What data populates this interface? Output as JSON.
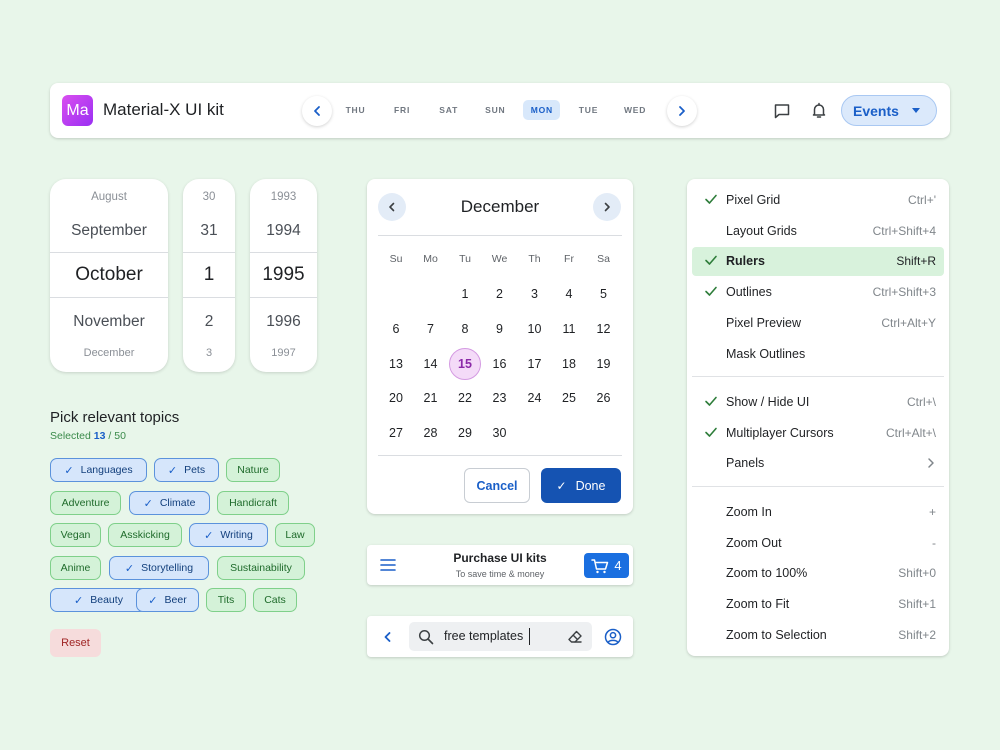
{
  "topbar": {
    "logo_text": "Ma",
    "title": "Material-X UI kit",
    "days": [
      "THU",
      "FRI",
      "SAT",
      "SUN",
      "MON",
      "TUE",
      "WED"
    ],
    "active_day": "MON",
    "events_label": "Events"
  },
  "pickers": {
    "month": [
      "August",
      "September",
      "October",
      "November",
      "December"
    ],
    "day": [
      "30",
      "31",
      "1",
      "2",
      "3"
    ],
    "year": [
      "1993",
      "1994",
      "1995",
      "1996",
      "1997"
    ]
  },
  "topics": {
    "title": "Pick relevant topics",
    "selected_prefix": "Selected",
    "selected_count": "13",
    "selected_total": "/ 50",
    "chips": [
      {
        "label": "Languages",
        "selected": true
      },
      {
        "label": "Pets",
        "selected": true
      },
      {
        "label": "Nature",
        "selected": false
      },
      {
        "label": "Adventure",
        "selected": false
      },
      {
        "label": "Climate",
        "selected": true
      },
      {
        "label": "Handicraft",
        "selected": false
      },
      {
        "label": "Vegan",
        "selected": false
      },
      {
        "label": "Asskicking",
        "selected": false
      },
      {
        "label": "Writing",
        "selected": true
      },
      {
        "label": "Law",
        "selected": false
      },
      {
        "label": "Anime",
        "selected": false
      },
      {
        "label": "Storytelling",
        "selected": true
      },
      {
        "label": "Sustainability",
        "selected": false
      },
      {
        "label": "Beauty",
        "selected": true
      },
      {
        "label": "Beer",
        "selected": true
      },
      {
        "label": "Tits",
        "selected": false
      },
      {
        "label": "Cats",
        "selected": false
      }
    ],
    "reset_label": "Reset"
  },
  "calendar": {
    "month": "December",
    "weekdays": [
      "Su",
      "Mo",
      "Tu",
      "We",
      "Th",
      "Fr",
      "Sa"
    ],
    "first_weekday_index": 2,
    "days_in_month": 30,
    "selected_day": 15,
    "cancel_label": "Cancel",
    "done_label": "Done"
  },
  "purchase": {
    "title": "Purchase UI kits",
    "subtitle": "To save time & money",
    "cart_count": "4"
  },
  "search": {
    "value": "free templates"
  },
  "menu": {
    "groups": [
      [
        {
          "label": "Pixel Grid",
          "shortcut": "Ctrl+'",
          "checked": true,
          "highlighted": false
        },
        {
          "label": "Layout Grids",
          "shortcut": "Ctrl+Shift+4",
          "checked": false,
          "highlighted": false
        },
        {
          "label": "Rulers",
          "shortcut": "Shift+R",
          "checked": true,
          "highlighted": true
        },
        {
          "label": "Outlines",
          "shortcut": "Ctrl+Shift+3",
          "checked": true,
          "highlighted": false
        },
        {
          "label": "Pixel Preview",
          "shortcut": "Ctrl+Alt+Y",
          "checked": false,
          "highlighted": false
        },
        {
          "label": "Mask Outlines",
          "shortcut": "",
          "checked": false,
          "highlighted": false
        }
      ],
      [
        {
          "label": "Show / Hide UI",
          "shortcut": "Ctrl+\\",
          "checked": true,
          "highlighted": false
        },
        {
          "label": "Multiplayer Cursors",
          "shortcut": "Ctrl+Alt+\\",
          "checked": true,
          "highlighted": false
        },
        {
          "label": "Panels",
          "shortcut": "",
          "checked": false,
          "highlighted": false,
          "submenu": true
        }
      ],
      [
        {
          "label": "Zoom In",
          "shortcut": "+",
          "checked": false,
          "highlighted": false
        },
        {
          "label": "Zoom Out",
          "shortcut": "-",
          "checked": false,
          "highlighted": false
        },
        {
          "label": "Zoom to 100%",
          "shortcut": "Shift+0",
          "checked": false,
          "highlighted": false
        },
        {
          "label": "Zoom to Fit",
          "shortcut": "Shift+1",
          "checked": false,
          "highlighted": false
        },
        {
          "label": "Zoom to Selection",
          "shortcut": "Shift+2",
          "checked": false,
          "highlighted": false
        }
      ]
    ]
  },
  "colors": {
    "background": "#e8f6ea",
    "accent": "#1a5fc8",
    "today": "#f4dbf8",
    "chip_selected": "#d6e6fb",
    "chip_unselected": "#d4f2d8"
  }
}
